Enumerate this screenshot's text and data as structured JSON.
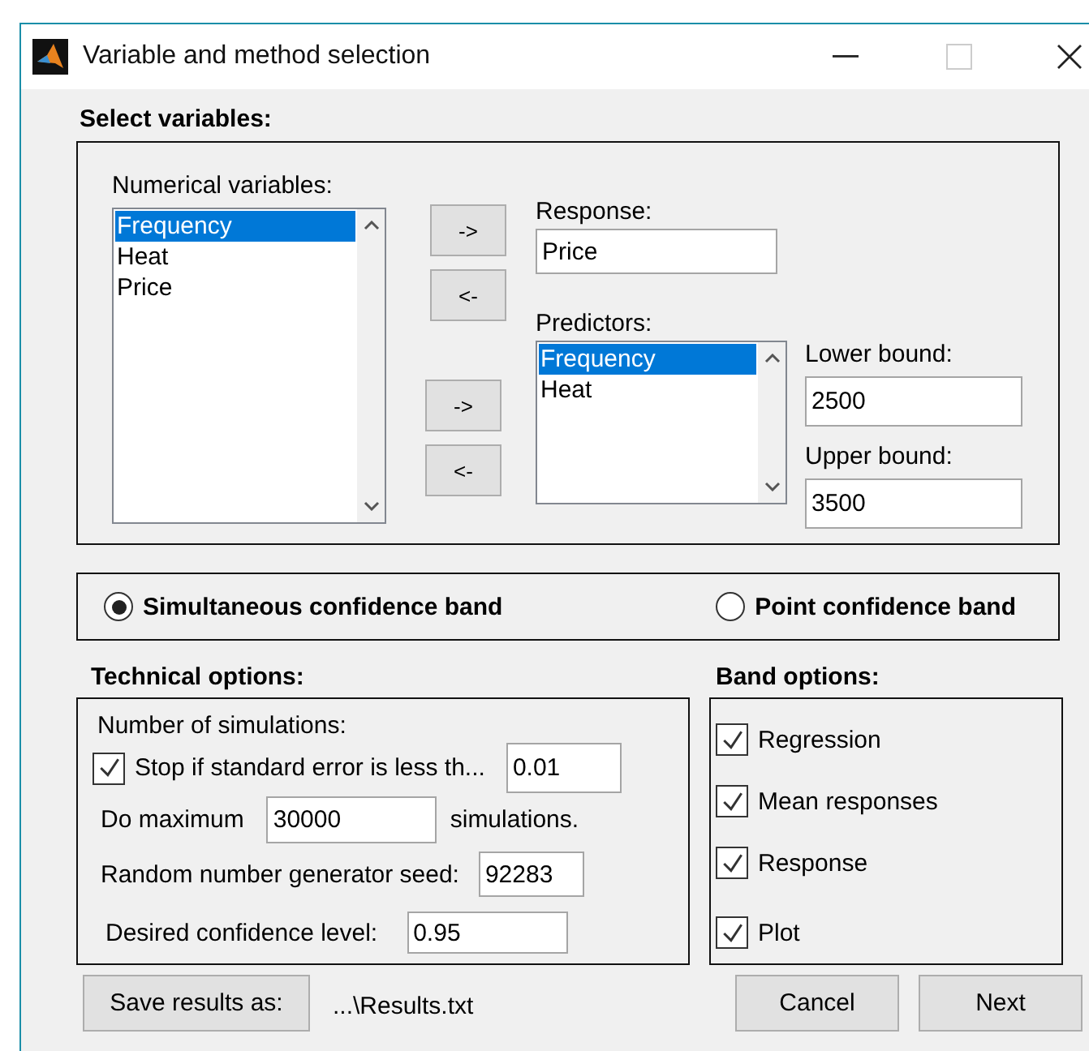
{
  "window": {
    "title": "Variable and method selection"
  },
  "select_variables": {
    "heading": "Select variables:",
    "numerical": {
      "label": "Numerical variables:",
      "items": [
        {
          "label": "Frequency",
          "selected": true
        },
        {
          "label": "Heat",
          "selected": false
        },
        {
          "label": "Price",
          "selected": false
        }
      ]
    },
    "response_buttons": [
      "->",
      "<-"
    ],
    "predictor_buttons": [
      "->",
      "<-"
    ],
    "response": {
      "label": "Response:",
      "value": "Price"
    },
    "predictors": {
      "label": "Predictors:",
      "items": [
        {
          "label": "Frequency",
          "selected": true
        },
        {
          "label": "Heat",
          "selected": false
        }
      ]
    },
    "lower_bound": {
      "label": "Lower bound:",
      "value": "2500"
    },
    "upper_bound": {
      "label": "Upper bound:",
      "value": "3500"
    }
  },
  "band_type": [
    {
      "label": "Simultaneous confidence band",
      "selected": true
    },
    {
      "label": "Point confidence band",
      "selected": false
    }
  ],
  "technical_options": {
    "heading": "Technical options:",
    "rows": [
      {
        "kind": "label",
        "text": "Number of simulations:"
      },
      {
        "kind": "check",
        "label": "Stop if standard error is less th...",
        "checked": true,
        "value": "0.01"
      },
      {
        "kind": "max",
        "label": "Do maximum",
        "value": "30000",
        "suffix": "simulations."
      },
      {
        "kind": "seed",
        "label": "Random number generator seed:",
        "value": "92283"
      },
      {
        "kind": "level",
        "label": "Desired confidence level:",
        "value": "0.95"
      }
    ]
  },
  "band_options": {
    "heading": "Band options:",
    "items": [
      {
        "label": "Regression",
        "checked": true
      },
      {
        "label": "Mean responses",
        "checked": true
      },
      {
        "label": "Response",
        "checked": true
      },
      {
        "label": "Plot",
        "checked": true
      }
    ]
  },
  "save": {
    "button": "Save results as:",
    "path": "...\\Results.txt"
  },
  "buttons": [
    "Cancel",
    "Next"
  ]
}
